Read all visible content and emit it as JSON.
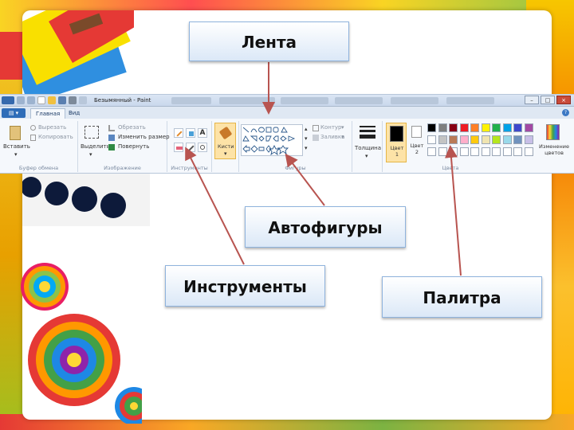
{
  "callouts": {
    "ribbon": "Лента",
    "shapes": "Автофигуры",
    "tools": "Инструменты",
    "palette": "Палитра"
  },
  "window": {
    "title": "Безымянный - Paint"
  },
  "tabs": [
    "Главная",
    "Вид"
  ],
  "clipboard": {
    "paste": "Вставить",
    "cut": "Вырезать",
    "copy": "Копировать",
    "label": "Буфер обмена"
  },
  "image": {
    "select": "Выделить",
    "crop": "Обрезать",
    "resize": "Изменить размер",
    "rotate": "Повернуть",
    "label": "Изображение"
  },
  "tools": {
    "label": "Инструменты",
    "brushes": "Кисти"
  },
  "shapes": {
    "outline": "Контур",
    "fill": "Заливка",
    "label": "Фигуры"
  },
  "size": {
    "label": "Толщина"
  },
  "colors": {
    "color1": "Цвет 1",
    "color2": "Цвет 2",
    "edit": "Изменение цветов",
    "label": "Цвета",
    "row1": [
      "#000000",
      "#7f7f7f",
      "#880015",
      "#ed1c24",
      "#ff7f27",
      "#fff200",
      "#22b14c",
      "#00a2e8",
      "#3f48cc",
      "#a349a4"
    ],
    "row2": [
      "#ffffff",
      "#c3c3c3",
      "#b97a57",
      "#ffaec9",
      "#ffc90e",
      "#efe4b0",
      "#b5e61d",
      "#99d9ea",
      "#7092be",
      "#c8bfe7"
    ]
  },
  "theme": {
    "accent": "#2f6db8",
    "arrow": "#b85450"
  }
}
